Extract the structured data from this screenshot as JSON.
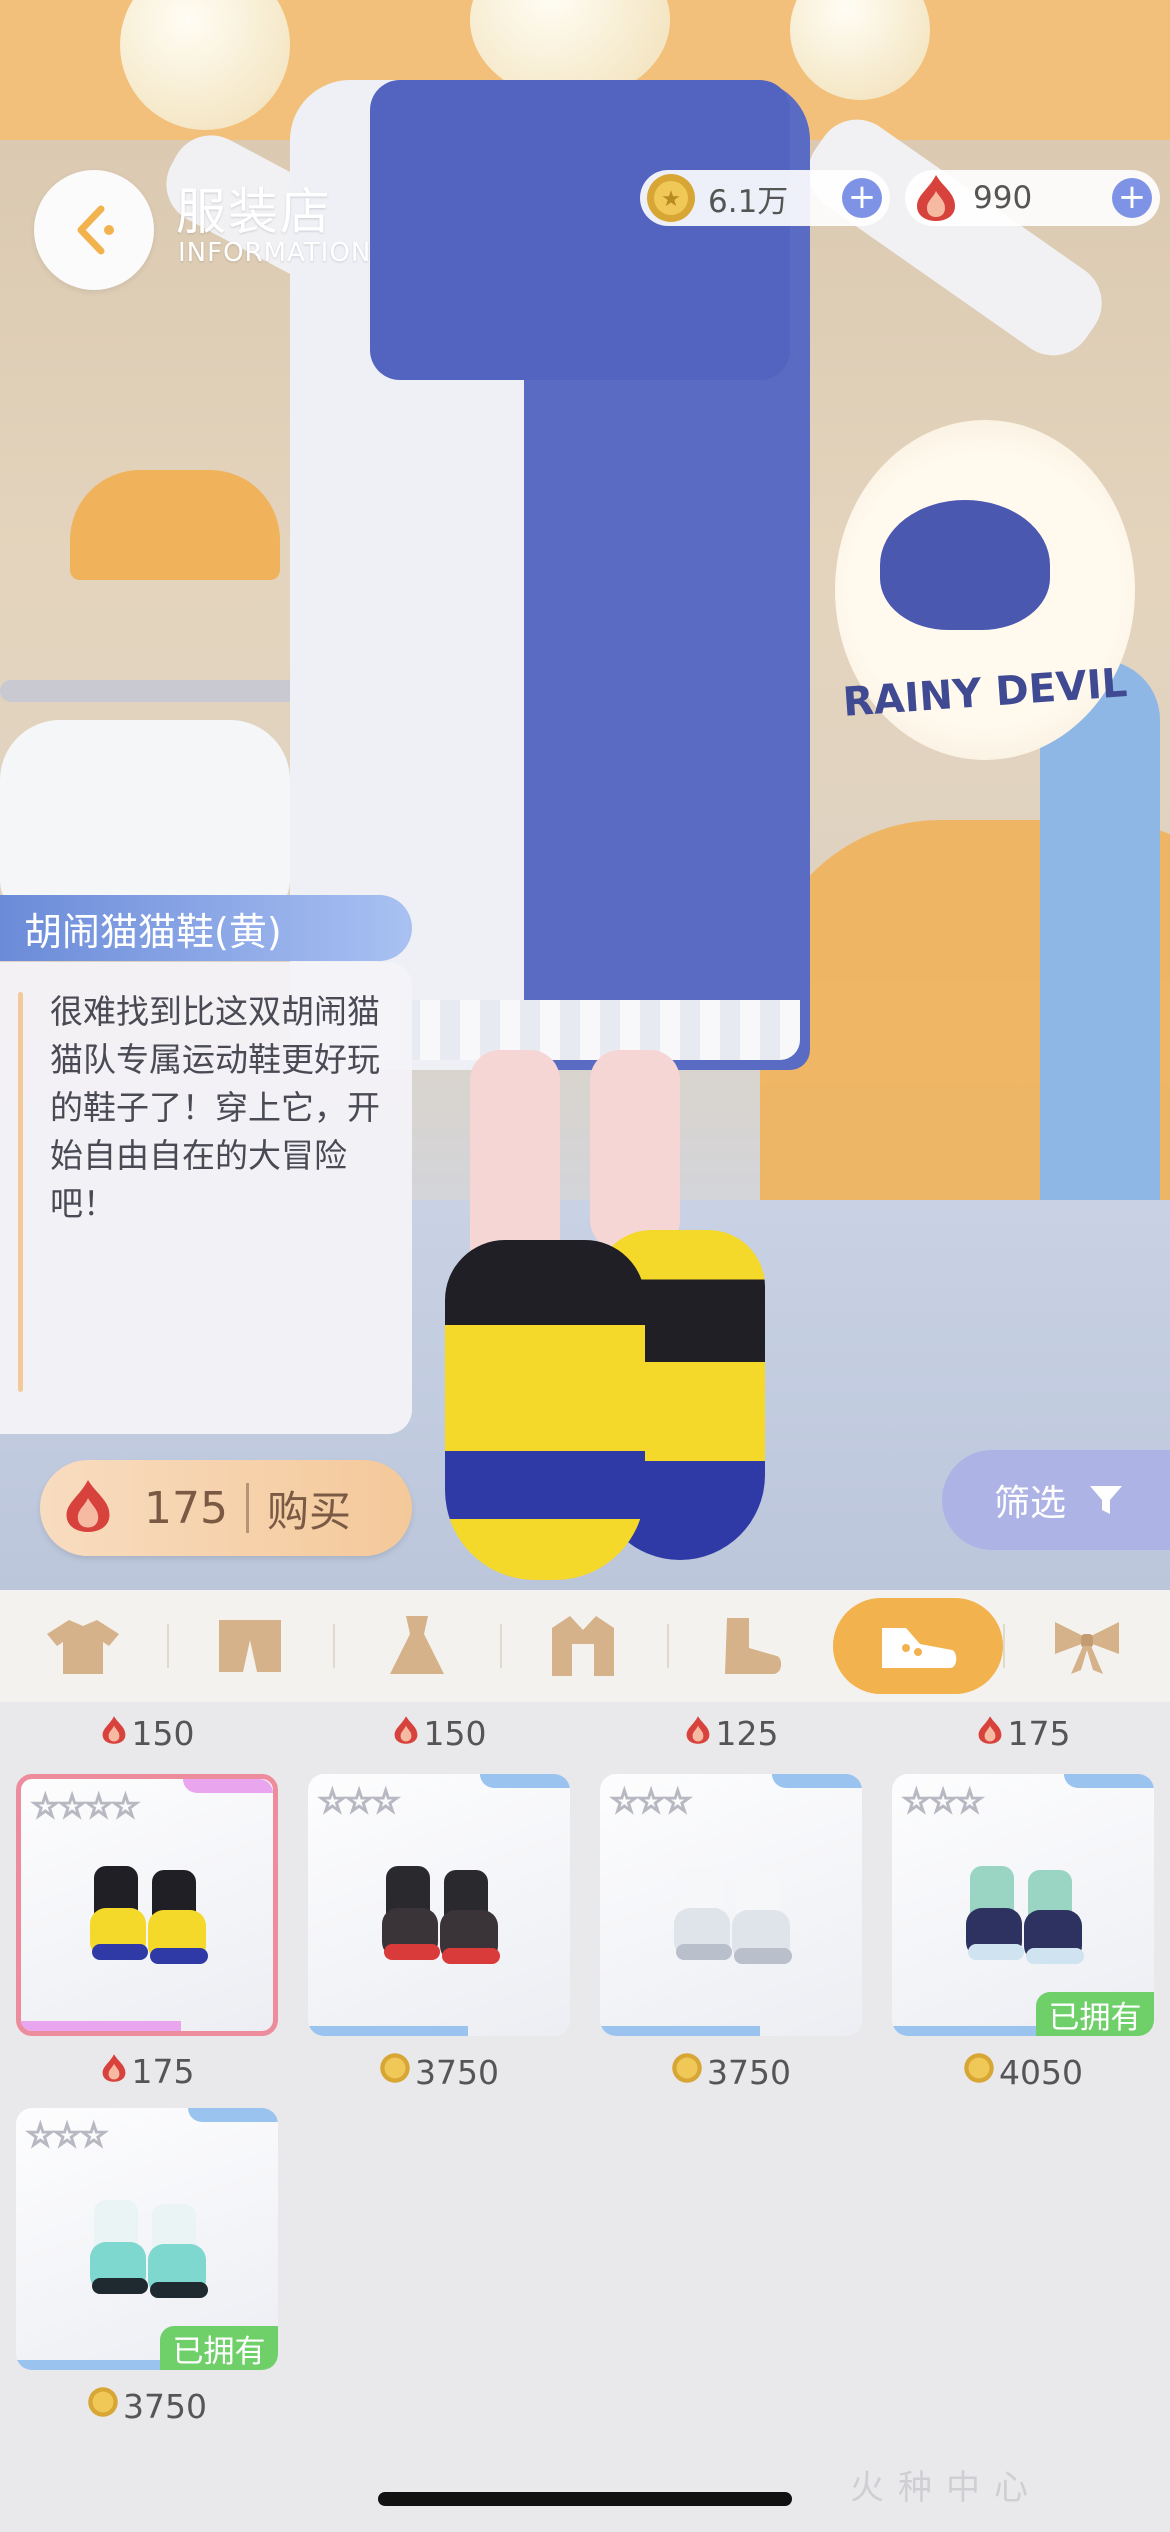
{
  "header": {
    "title": "服装店",
    "subtitle": "INFORMATION",
    "coins": "6.1万",
    "gems": "990"
  },
  "scene": {
    "logo_text": "RAINY DEVIL"
  },
  "item": {
    "name": "胡闹猫猫鞋(黄)",
    "description": "很难找到比这双胡闹猫猫队专属运动鞋更好玩的鞋子了！穿上它，开始自由自在的大冒险吧！"
  },
  "buy": {
    "price": "175",
    "label": "购买"
  },
  "filter": {
    "label": "筛选"
  },
  "categories": [
    {
      "icon": "shirt-icon"
    },
    {
      "icon": "pants-icon"
    },
    {
      "icon": "dress-icon"
    },
    {
      "icon": "coat-icon"
    },
    {
      "icon": "sock-icon"
    },
    {
      "icon": "shoe-icon",
      "active": true
    },
    {
      "icon": "bow-icon"
    }
  ],
  "prev_row_prices": [
    "150",
    "150",
    "125",
    "175"
  ],
  "items": [
    {
      "stars": 4,
      "price": "175",
      "currency": "gem",
      "selected": true,
      "owned": false,
      "colors": [
        "#f4d82a",
        "#2f3aa7",
        "#1f1f25"
      ]
    },
    {
      "stars": 3,
      "price": "3750",
      "currency": "coin",
      "selected": false,
      "owned": false,
      "colors": [
        "#3a3438",
        "#d93a3a",
        "#2a2a2e"
      ]
    },
    {
      "stars": 3,
      "price": "3750",
      "currency": "coin",
      "selected": false,
      "owned": false,
      "colors": [
        "#dfe3ea",
        "#b9c0cc",
        "#f6f7f9"
      ]
    },
    {
      "stars": 3,
      "price": "4050",
      "currency": "coin",
      "selected": false,
      "owned": true,
      "colors": [
        "#2d3260",
        "#cfe3f0",
        "#9ad5c4"
      ]
    },
    {
      "stars": 3,
      "price": "3750",
      "currency": "coin",
      "selected": false,
      "owned": true,
      "colors": [
        "#7fd8d0",
        "#1f2a30",
        "#eaf4f4"
      ]
    }
  ],
  "owned_label": "已拥有",
  "watermark": "火种中心",
  "colors": {
    "accent_orange": "#f2b24e",
    "owned_green": "#6fd06a",
    "selected_pink": "#ec8c9c"
  }
}
